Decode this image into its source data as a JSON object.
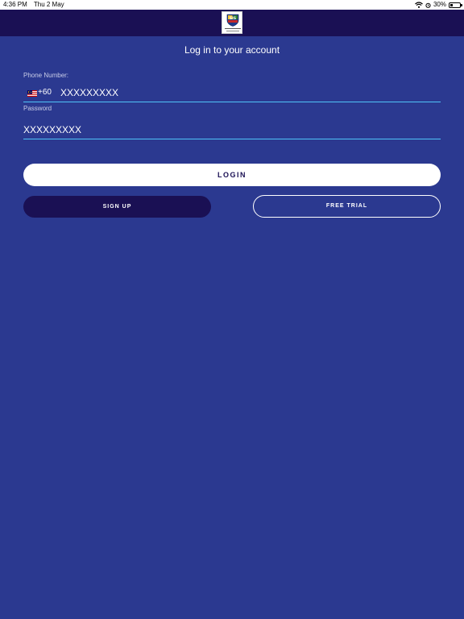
{
  "status_bar": {
    "time": "4:36 PM",
    "date": "Thu 2 May",
    "battery": "30%",
    "battery_level": 0.3,
    "icons": [
      "wifi-icon",
      "alarm-icon",
      "battery-icon"
    ]
  },
  "header": {
    "logo": "school-crest-logo"
  },
  "login": {
    "title": "Log in to your account",
    "phone_label": "Phone Number:",
    "country_flag": "malaysia-flag-icon",
    "country_code": "+60",
    "phone_value": "XXXXXXXXX",
    "password_label": "Password",
    "password_value": "XXXXXXXXX",
    "login_label": "LOGIN",
    "signup_label": "SIGN UP",
    "trial_label": "FREE TRIAL"
  },
  "colors": {
    "background": "#2b3990",
    "header": "#1a1054",
    "underline": "#4fc3f7",
    "button_light": "#ffffff",
    "button_dark": "#1a1054"
  }
}
